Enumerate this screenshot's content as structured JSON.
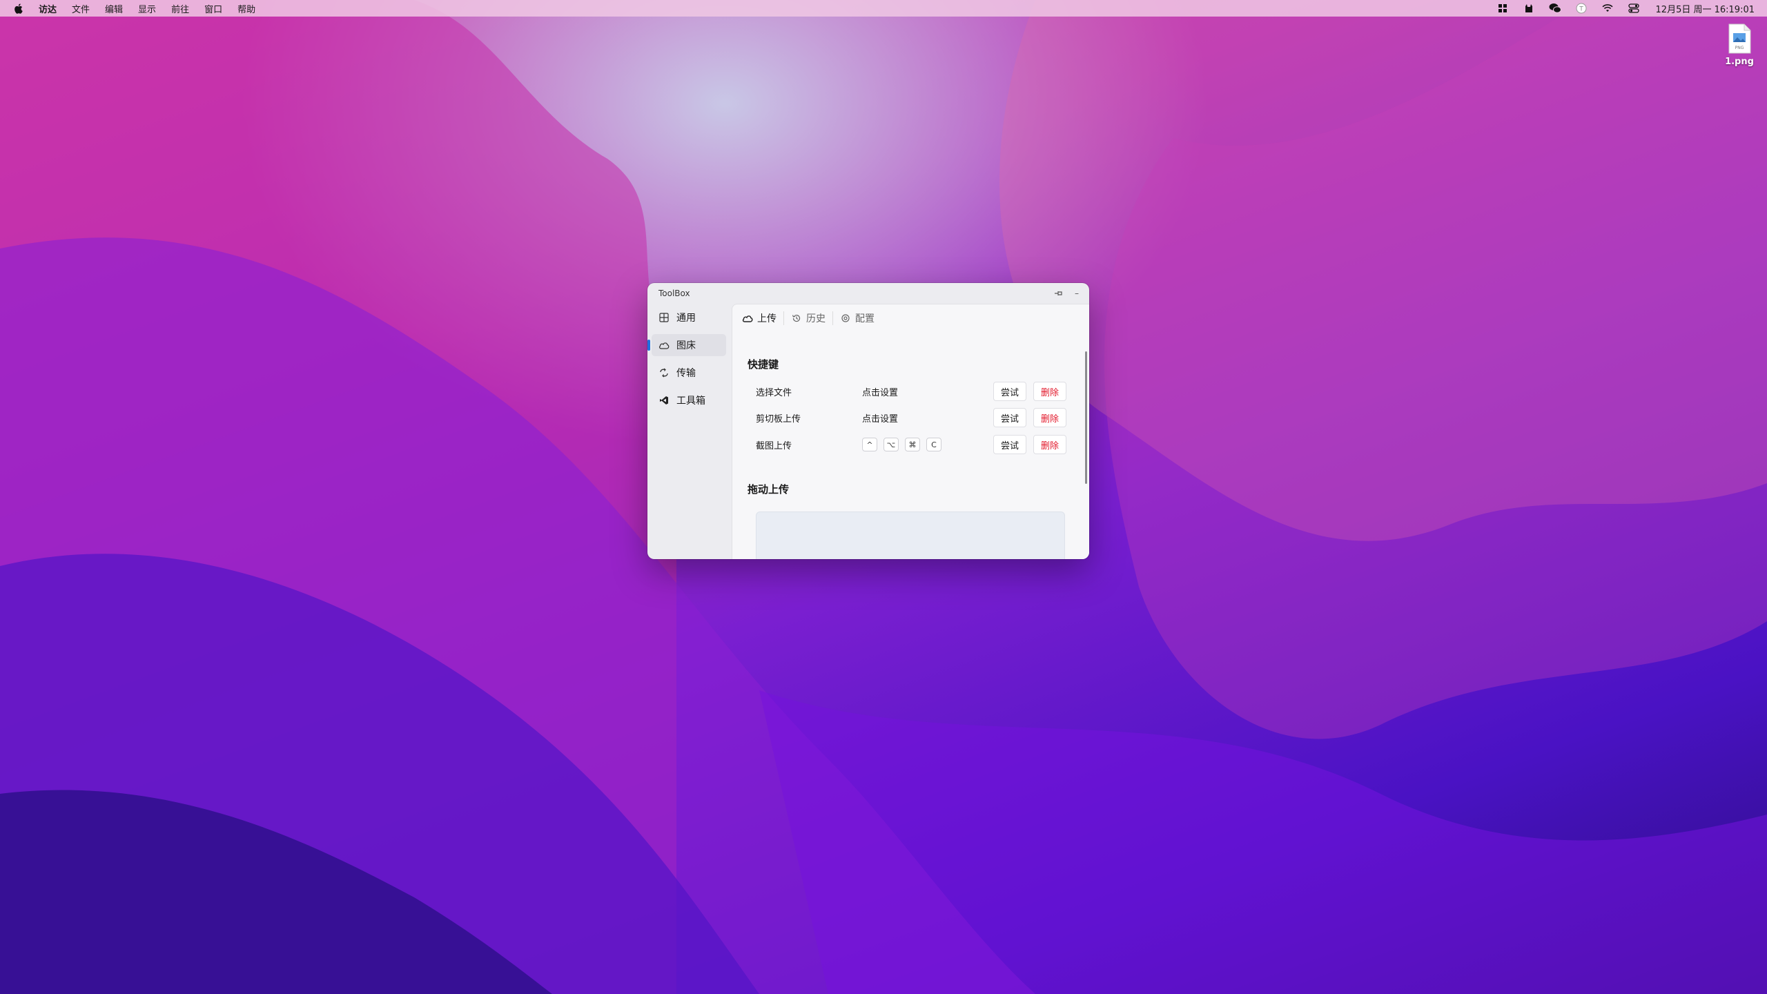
{
  "menubar": {
    "apple_icon": "apple-icon",
    "items": [
      "访达",
      "文件",
      "编辑",
      "显示",
      "前往",
      "窗口",
      "帮助"
    ],
    "status_icons": [
      "launchpad-icon",
      "cat-icon",
      "wechat-icon",
      "typora-icon",
      "wifi-icon",
      "control-center-icon"
    ],
    "clock": "12月5日 周一 16:19:01"
  },
  "desktop": {
    "file_label": "1.png",
    "file_badge": "PNG"
  },
  "window": {
    "title": "ToolBox",
    "pin_icon": "pin-icon",
    "minimize_label": "–",
    "sidebar": [
      {
        "label": "通用",
        "icon": "layout-icon"
      },
      {
        "label": "图床",
        "icon": "cloud-icon",
        "active": true
      },
      {
        "label": "传输",
        "icon": "transfer-icon"
      },
      {
        "label": "工具箱",
        "icon": "vscode-icon"
      }
    ],
    "tabs": [
      {
        "label": "上传",
        "icon": "cloud-upload-icon",
        "active": true
      },
      {
        "label": "历史",
        "icon": "history-icon"
      },
      {
        "label": "配置",
        "icon": "settings-icon"
      }
    ],
    "shortcuts": {
      "title": "快捷键",
      "rows": [
        {
          "label": "选择文件",
          "value": "点击设置",
          "try": "尝试",
          "delete": "删除"
        },
        {
          "label": "剪切板上传",
          "value": "点击设置",
          "try": "尝试",
          "delete": "删除"
        },
        {
          "label": "截图上传",
          "keys": [
            "^",
            "⌥",
            "⌘",
            "C"
          ],
          "try": "尝试",
          "delete": "删除"
        }
      ]
    },
    "drag_upload": {
      "title": "拖动上传"
    }
  },
  "colors": {
    "accent": "#1f6fe0",
    "danger": "#e21a2c"
  }
}
